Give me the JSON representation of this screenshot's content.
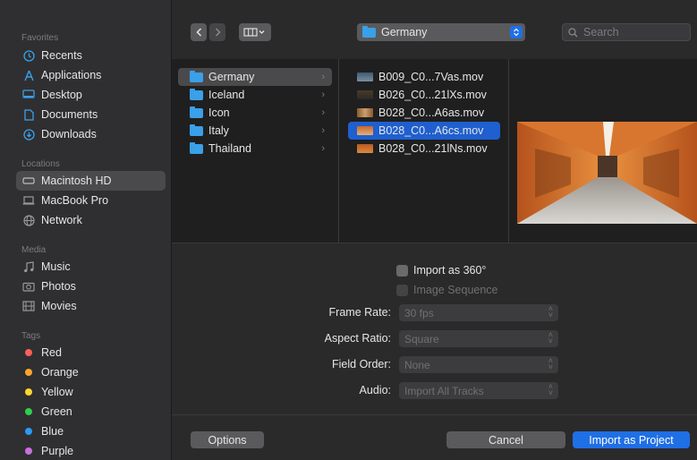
{
  "sidebar": {
    "favorites_title": "Favorites",
    "favorites": [
      {
        "label": "Recents",
        "icon": "clock-icon"
      },
      {
        "label": "Applications",
        "icon": "applications-icon"
      },
      {
        "label": "Desktop",
        "icon": "desktop-icon"
      },
      {
        "label": "Documents",
        "icon": "document-icon"
      },
      {
        "label": "Downloads",
        "icon": "download-icon"
      }
    ],
    "locations_title": "Locations",
    "locations": [
      {
        "label": "Macintosh HD",
        "icon": "harddisk-icon",
        "selected": true
      },
      {
        "label": "MacBook Pro",
        "icon": "laptop-icon"
      },
      {
        "label": "Network",
        "icon": "globe-icon"
      }
    ],
    "media_title": "Media",
    "media": [
      {
        "label": "Music",
        "icon": "music-icon"
      },
      {
        "label": "Photos",
        "icon": "camera-icon"
      },
      {
        "label": "Movies",
        "icon": "film-icon"
      }
    ],
    "tags_title": "Tags",
    "tags": [
      {
        "label": "Red",
        "color": "#ff5f57"
      },
      {
        "label": "Orange",
        "color": "#ffa629"
      },
      {
        "label": "Yellow",
        "color": "#ffd62e"
      },
      {
        "label": "Green",
        "color": "#2fcf4a"
      },
      {
        "label": "Blue",
        "color": "#2a9bf5"
      },
      {
        "label": "Purple",
        "color": "#c870dc"
      }
    ]
  },
  "toolbar": {
    "path_label": "Germany",
    "search_placeholder": "Search"
  },
  "browser": {
    "folders": [
      {
        "label": "Germany",
        "selected": true
      },
      {
        "label": "Iceland"
      },
      {
        "label": "Icon"
      },
      {
        "label": "Italy"
      },
      {
        "label": "Thailand"
      }
    ],
    "files": [
      {
        "label": "B009_C0...7Vas.mov"
      },
      {
        "label": "B026_C0...21lXs.mov"
      },
      {
        "label": "B028_C0...A6as.mov"
      },
      {
        "label": "B028_C0...A6cs.mov",
        "selected": true
      },
      {
        "label": "B028_C0...21lNs.mov"
      }
    ]
  },
  "options": {
    "import_360": "Import as 360°",
    "image_sequence": "Image Sequence",
    "frame_rate_label": "Frame Rate:",
    "frame_rate_value": "30 fps",
    "aspect_ratio_label": "Aspect Ratio:",
    "aspect_ratio_value": "Square",
    "field_order_label": "Field Order:",
    "field_order_value": "None",
    "audio_label": "Audio:",
    "audio_value": "Import All Tracks"
  },
  "buttons": {
    "options": "Options",
    "cancel": "Cancel",
    "import": "Import as Project"
  }
}
